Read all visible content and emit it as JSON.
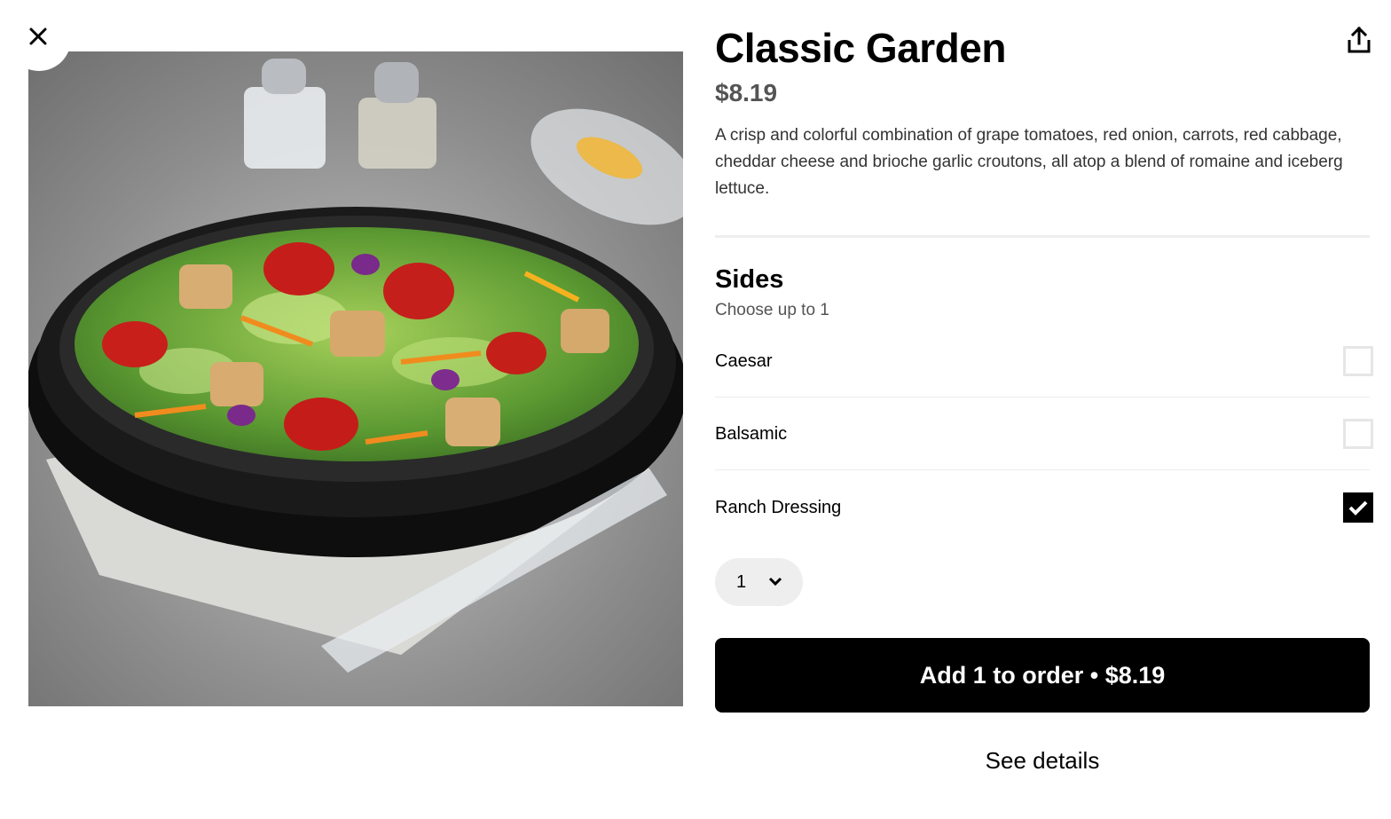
{
  "close": {
    "icon": "close-icon"
  },
  "share": {
    "icon": "share-icon"
  },
  "image": {
    "subject": "garden salad in black bowl",
    "icon": "food-photo"
  },
  "item": {
    "title": "Classic Garden",
    "price": "$8.19",
    "description": "A crisp and colorful combination of grape tomatoes, red onion, carrots, red cabbage, cheddar cheese and brioche garlic croutons, all atop a blend of romaine and iceberg lettuce."
  },
  "sides": {
    "title": "Sides",
    "subtitle": "Choose up to 1",
    "options": [
      {
        "label": "Caesar",
        "checked": false
      },
      {
        "label": "Balsamic",
        "checked": false
      },
      {
        "label": "Ranch Dressing",
        "checked": true
      }
    ]
  },
  "quantity": {
    "value": "1",
    "icon": "chevron-down-icon"
  },
  "order_button": {
    "label": "Add 1 to order • $8.19"
  },
  "details_link": {
    "label": "See details"
  },
  "colors": {
    "primary": "#000000",
    "muted_text": "#545454",
    "divider": "#eeeeee"
  }
}
